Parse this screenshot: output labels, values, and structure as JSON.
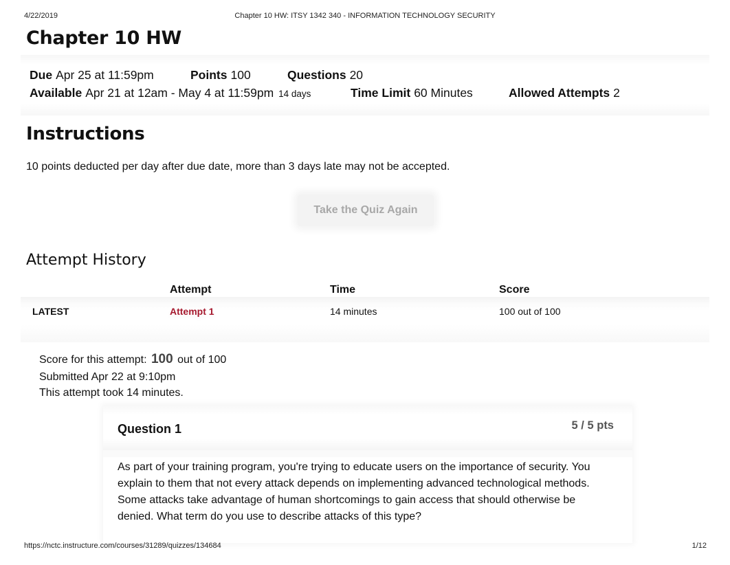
{
  "print_header": {
    "date": "4/22/2019",
    "title": "Chapter 10 HW: ITSY 1342 340 - INFORMATION TECHNOLOGY SECURITY"
  },
  "page_title": "Chapter 10 HW",
  "quiz_details": {
    "due": {
      "label": "Due",
      "value": "Apr 25 at 11:59pm"
    },
    "points": {
      "label": "Points",
      "value": "100"
    },
    "questions": {
      "label": "Questions",
      "value": "20"
    },
    "available": {
      "label": "Available",
      "value": "Apr 21 at 12am - May 4 at 11:59pm",
      "note": "14 days"
    },
    "time_limit": {
      "label": "Time Limit",
      "value": "60 Minutes"
    },
    "allowed_attempts": {
      "label": "Allowed Attempts",
      "value": "2"
    }
  },
  "instructions": {
    "heading": "Instructions",
    "text": "10 points deducted per day after due date, more than 3 days late may not be accepted."
  },
  "retake_button": {
    "label": "Take the Quiz Again"
  },
  "attempt_history": {
    "heading": "Attempt History",
    "columns": [
      "",
      "Attempt",
      "Time",
      "Score"
    ],
    "rows": [
      {
        "tag": "LATEST",
        "attempt": "Attempt 1",
        "time": "14 minutes",
        "score": "100 out of 100"
      }
    ]
  },
  "attempt_summary": {
    "score_label": "Score for this attempt:",
    "score_value": "100",
    "score_suffix": "out of 100",
    "submitted": "Submitted Apr 22 at 9:10pm",
    "duration": "This attempt took 14 minutes."
  },
  "question": {
    "title": "Question 1",
    "points": "5 / 5 pts",
    "text": "As part of your training program, you're trying to educate users on the importance of security. You explain to them that not every attack depends on implementing advanced technological methods. Some attacks take advantage of human shortcomings to gain access that should otherwise be denied. What term do you use to describe attacks of this type?"
  },
  "print_footer": {
    "url": "https://nctc.instructure.com/courses/31289/quizzes/134684",
    "page": "1/12"
  },
  "colors": {
    "link": "#a6192e",
    "muted_button_text": "#a8a8a8"
  }
}
